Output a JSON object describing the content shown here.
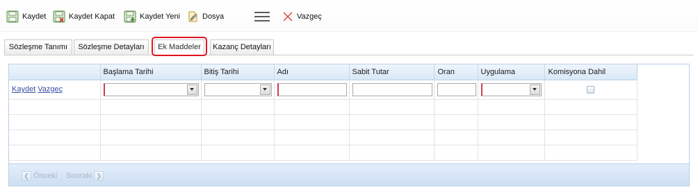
{
  "toolbar": {
    "save_label": "Kaydet",
    "save_close_label": "Kaydet Kapat",
    "save_new_label": "Kaydet Yeni",
    "file_label": "Dosya",
    "menu_icon": "hamburger-icon",
    "cancel_label": "Vazgeç"
  },
  "tabs": [
    {
      "label": "Sözleşme Tanımı",
      "active": false
    },
    {
      "label": "Sözleşme Detayları",
      "active": false
    },
    {
      "label": "Ek Maddeler",
      "active": true
    },
    {
      "label": "Kazanç Detayları",
      "active": false
    }
  ],
  "grid": {
    "columns": [
      "",
      "Başlama Tarihi",
      "Bitiş Tarihi",
      "Adı",
      "Sabit Tutar",
      "Oran",
      "Uygulama",
      "Komisyona Dahil"
    ],
    "edit_row": {
      "save_link": "Kaydet",
      "cancel_link": "Vazgeç",
      "baslama_tarihi": "",
      "bitis_tarihi": "",
      "adi": "",
      "sabit_tutar": "",
      "oran": "",
      "uygulama": "",
      "komisyona_dahil": false
    },
    "empty_rows": 4
  },
  "pager": {
    "prev_label": "Önceki",
    "next_label": "Sonraki"
  },
  "colors": {
    "accent_required": "#d23a4e",
    "highlight_box": "#e0141e",
    "grid_header": "#d9e8f7",
    "link": "#3a4fa3"
  }
}
